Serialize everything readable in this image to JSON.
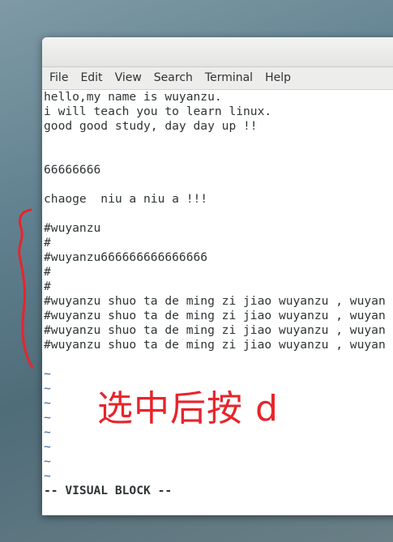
{
  "menubar": {
    "items": [
      "File",
      "Edit",
      "View",
      "Search",
      "Terminal",
      "Help"
    ]
  },
  "terminal": {
    "lines": [
      "hello,my name is wuyanzu.",
      "i will teach you to learn linux.",
      "good good study, day day up !!",
      "",
      "",
      "66666666",
      "",
      "chaoge  niu a niu a !!!",
      "",
      "#wuyanzu",
      "#",
      "#wuyanzu666666666666666",
      "#",
      "#",
      "#wuyanzu shuo ta de ming zi jiao wuyanzu , wuyan",
      "#wuyanzu shuo ta de ming zi jiao wuyanzu , wuyan",
      "#wuyanzu shuo ta de ming zi jiao wuyanzu , wuyan",
      "#wuyanzu shuo ta de ming zi jiao wuyanzu , wuyan",
      "",
      "~",
      "~",
      "~",
      "~",
      "~",
      "~",
      "~",
      "~"
    ],
    "mode": "-- VISUAL BLOCK --"
  },
  "annotation": {
    "text": "选中后按 d",
    "color": "#e8242b"
  },
  "colors": {
    "tilde": "#3465a4",
    "text": "#2e3436"
  }
}
